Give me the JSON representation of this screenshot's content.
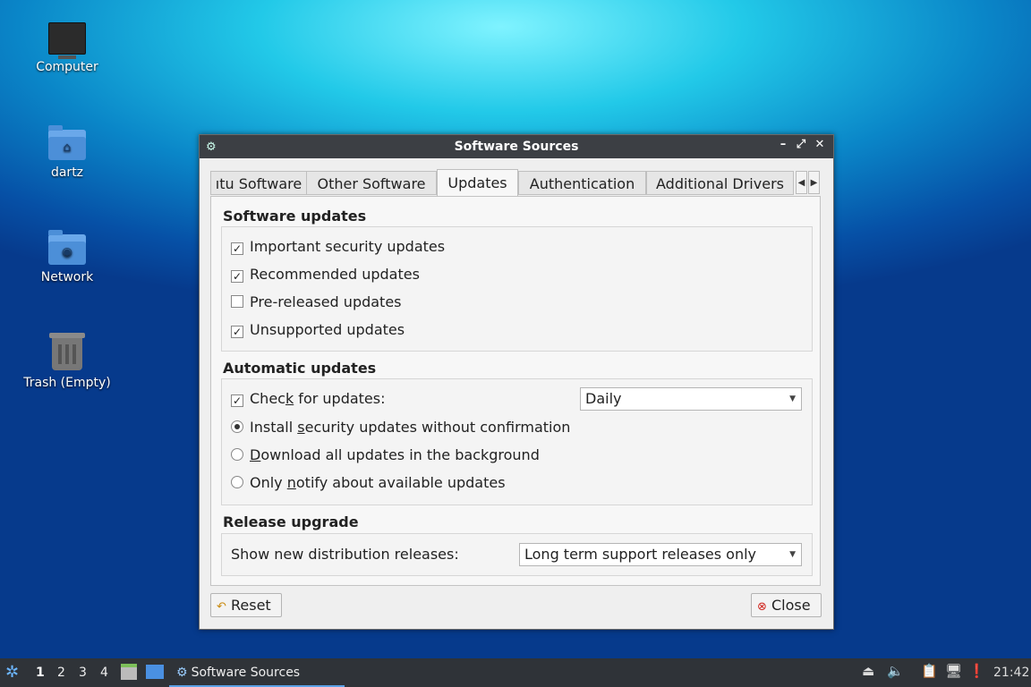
{
  "desktop": {
    "icons": [
      {
        "label": "Computer"
      },
      {
        "label": "dartz"
      },
      {
        "label": "Network"
      },
      {
        "label": "Trash (Empty)"
      }
    ]
  },
  "window": {
    "title": "Software Sources",
    "tabs": [
      "ıtu Software",
      "Other Software",
      "Updates",
      "Authentication",
      "Additional Drivers"
    ],
    "active_tab": "Updates",
    "software_updates": {
      "heading": "Software updates",
      "options": [
        {
          "label": "Important security updates",
          "checked": true
        },
        {
          "label": "Recommended updates",
          "checked": true
        },
        {
          "label": "Pre-released updates",
          "checked": false
        },
        {
          "label": "Unsupported updates",
          "checked": true
        }
      ]
    },
    "automatic_updates": {
      "heading": "Automatic updates",
      "check_prefix": "Chec",
      "check_mnemonic": "k",
      "check_suffix": " for updates:",
      "check_checked": true,
      "frequency": "Daily",
      "radios": [
        {
          "pre": "Install ",
          "mn": "s",
          "post": "ecurity updates without confirmation",
          "selected": true
        },
        {
          "pre": "",
          "mn": "D",
          "post": "ownload all updates in the background",
          "selected": false
        },
        {
          "pre": "Only ",
          "mn": "n",
          "post": "otify about available updates",
          "selected": false
        }
      ]
    },
    "release_upgrade": {
      "heading": "Release upgrade",
      "label": "Show new distribution releases:",
      "value": "Long term support releases only"
    },
    "buttons": {
      "reset": "Reset",
      "close": "Close"
    }
  },
  "taskbar": {
    "workspaces": [
      "1",
      "2",
      "3",
      "4"
    ],
    "active_workspace": "1",
    "task_label": "Software Sources",
    "clock": "21:42"
  }
}
